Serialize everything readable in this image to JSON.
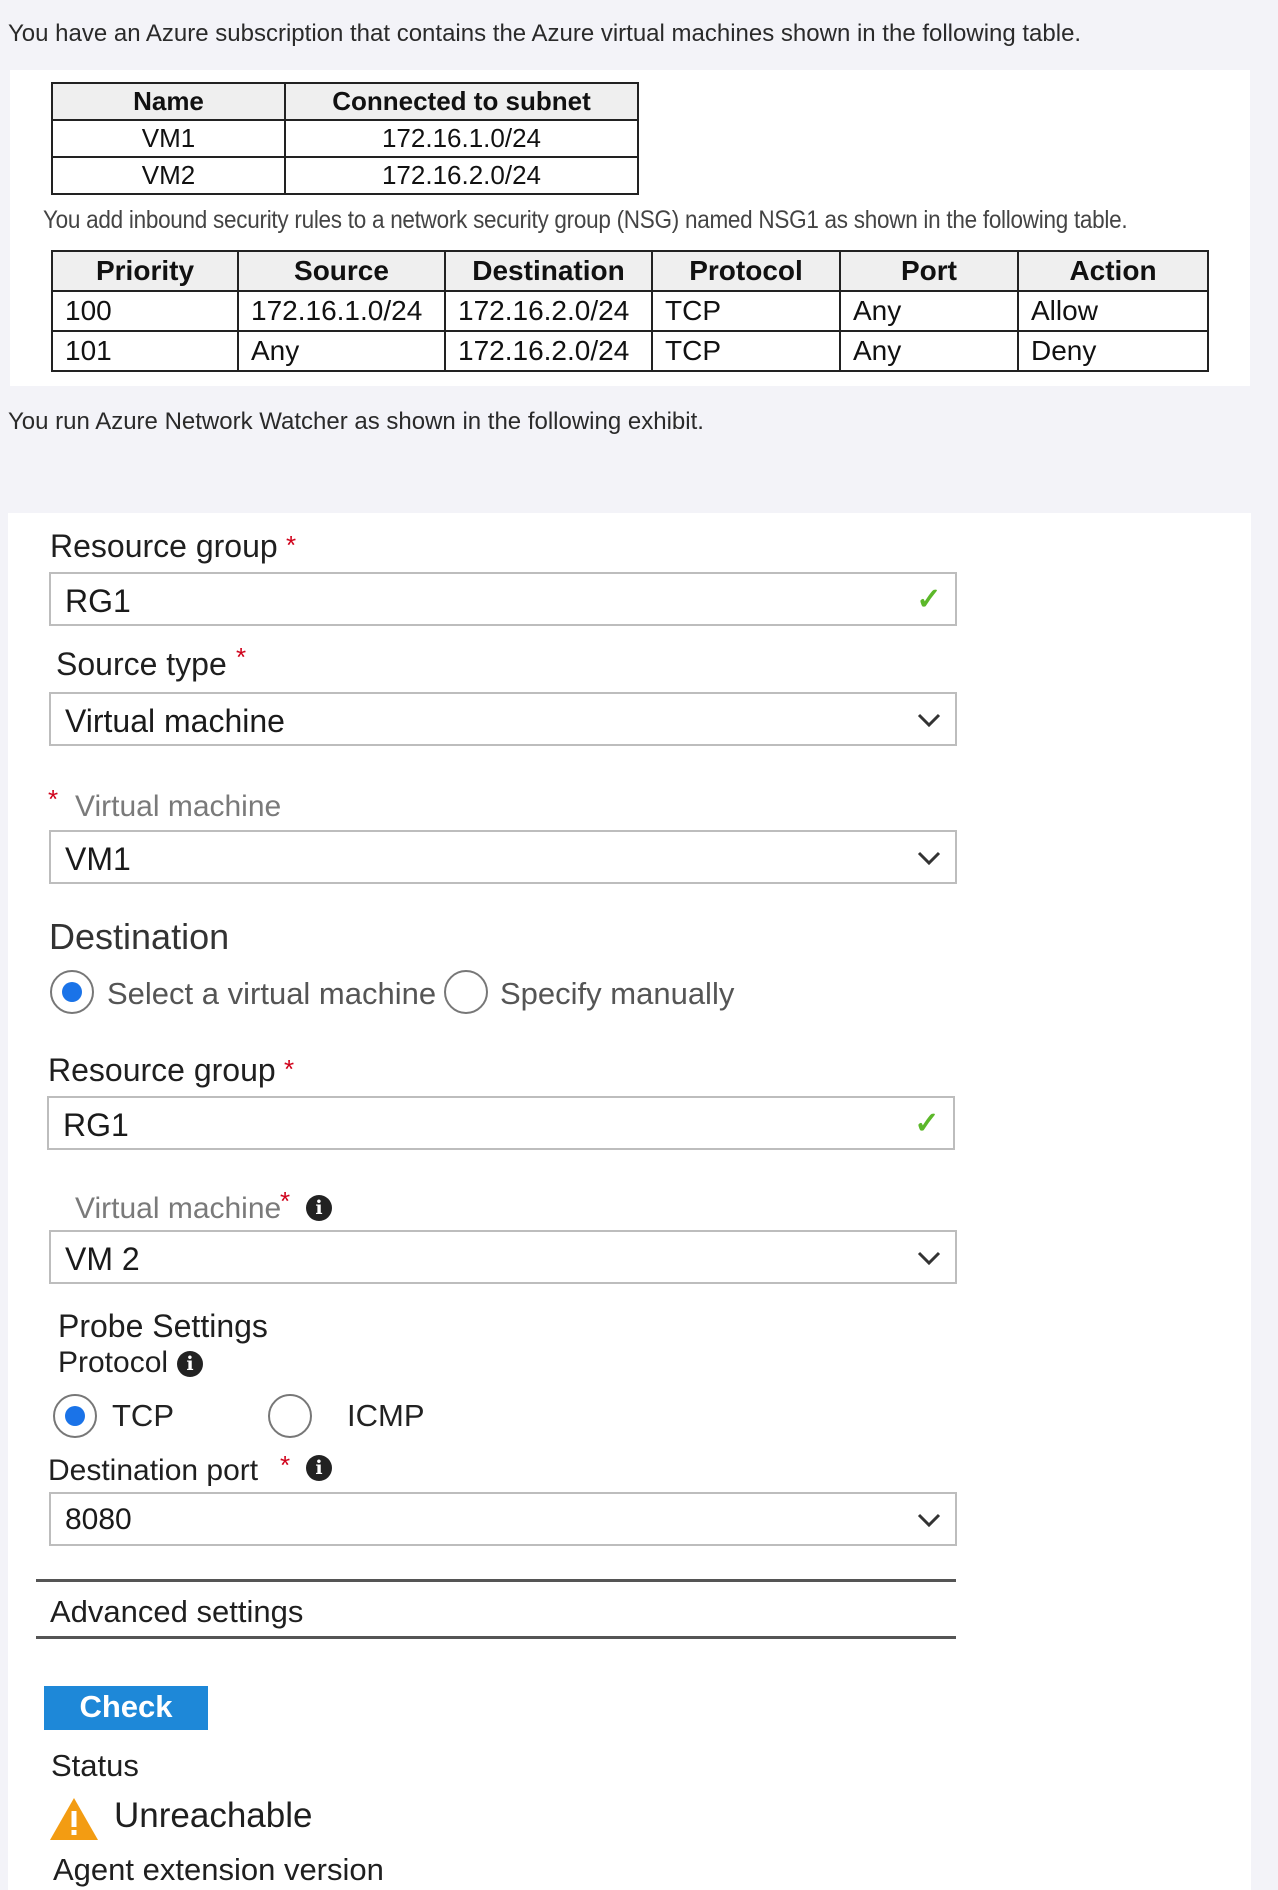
{
  "intro": {
    "line1": "You have an Azure subscription that contains the Azure virtual machines shown in the following table.",
    "line2": "You add inbound security rules to a network security group (NSG) named NSG1 as shown in the following table.",
    "line3": "You run Azure Network Watcher as shown in the following exhibit."
  },
  "vm_table": {
    "headers": [
      "Name",
      "Connected to subnet"
    ],
    "rows": [
      [
        "VM1",
        "172.16.1.0/24"
      ],
      [
        "VM2",
        "172.16.2.0/24"
      ]
    ]
  },
  "nsg_table": {
    "headers": [
      "Priority",
      "Source",
      "Destination",
      "Protocol",
      "Port",
      "Action"
    ],
    "rows": [
      [
        "100",
        "172.16.1.0/24",
        "172.16.2.0/24",
        "TCP",
        "Any",
        "Allow"
      ],
      [
        "101",
        "Any",
        "172.16.2.0/24",
        "TCP",
        "Any",
        "Deny"
      ]
    ]
  },
  "form": {
    "resource_group_label": "Resource group",
    "resource_group_value": "RG1",
    "source_type_label": "Source type",
    "source_type_value": "Virtual machine",
    "virtual_machine_label": "Virtual machine",
    "virtual_machine_value": "VM1",
    "destination_heading": "Destination",
    "dest_option_select": "Select a virtual machine",
    "dest_option_manual": "Specify manually",
    "dest_resource_group_label": "Resource group",
    "dest_resource_group_value": "RG1",
    "dest_vm_label": "Virtual machine",
    "dest_vm_value": "VM 2",
    "probe_settings_label": "Probe Settings",
    "protocol_label": "Protocol",
    "protocol_tcp": "TCP",
    "protocol_icmp": "ICMP",
    "dest_port_label": "Destination port",
    "dest_port_value": "8080",
    "advanced_settings": "Advanced settings",
    "check_button": "Check",
    "status_label": "Status",
    "status_value": "Unreachable",
    "agent_ext_label": "Agent extension version",
    "required_mark": "*",
    "info_mark": "i"
  },
  "colors": {
    "accent": "#1a73e8",
    "button": "#1e88d8",
    "required": "#d0021b",
    "valid": "#5cb82a",
    "warning": "#f39c12"
  }
}
